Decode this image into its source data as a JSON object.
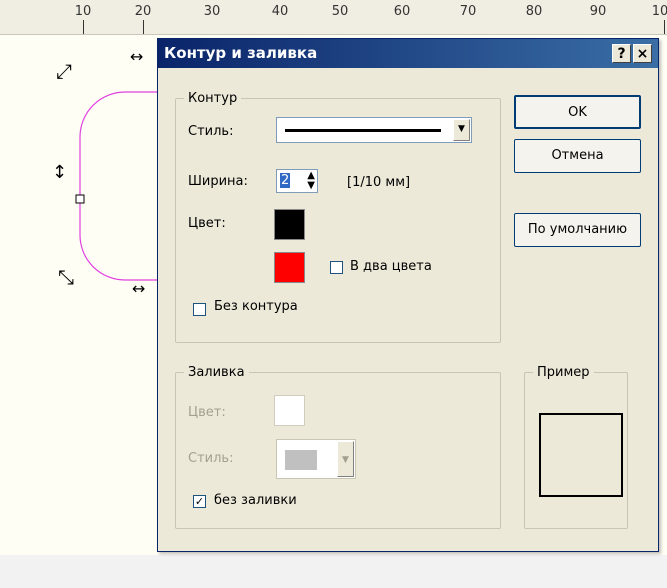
{
  "ruler": {
    "ticks": [
      "10",
      "20",
      "30",
      "40",
      "50",
      "60",
      "70",
      "80",
      "90",
      "10"
    ]
  },
  "canvas": {
    "shape_color": "#e040e0"
  },
  "dialog": {
    "title": "Контур и заливка",
    "help_button": "?",
    "close_button": "×",
    "outline": {
      "group_label": "Контур",
      "style_label": "Стиль:",
      "width_label": "Ширина:",
      "width_value": "2",
      "width_unit": "[1/10 мм]",
      "color_label": "Цвет:",
      "color1": "#000000",
      "color2": "#ff0000",
      "two_color_label": "В два цвета",
      "two_color_checked": false,
      "no_outline_label": "Без контура",
      "no_outline_checked": false
    },
    "fill": {
      "group_label": "Заливка",
      "color_label": "Цвет:",
      "style_label": "Стиль:",
      "no_fill_label": "без заливки",
      "no_fill_checked": true,
      "no_fill_mark": "✓"
    },
    "buttons": {
      "ok": "OK",
      "cancel": "Отмена",
      "default": "По умолчанию"
    },
    "preview": {
      "group_label": "Пример"
    }
  }
}
